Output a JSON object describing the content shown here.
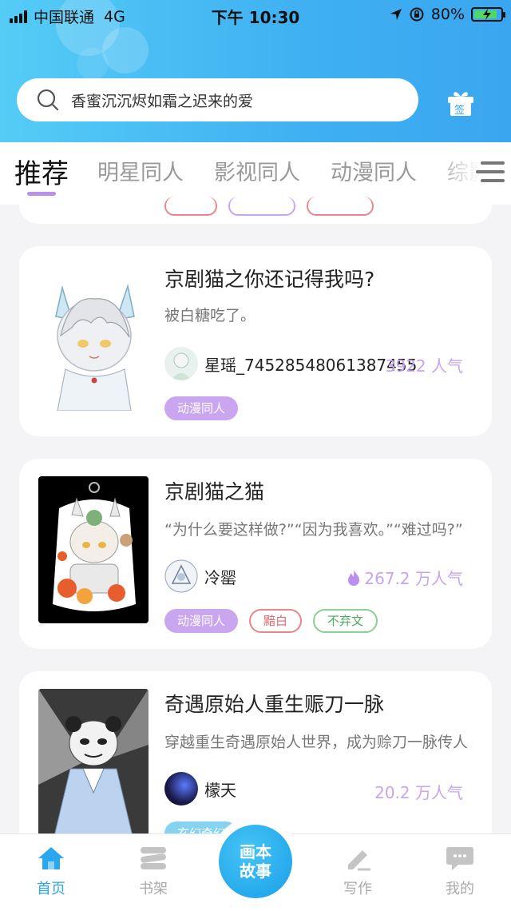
{
  "status_bar": {
    "carrier": "中国联通",
    "network": "4G",
    "time": "下午 10:30",
    "battery": "80%"
  },
  "search": {
    "placeholder": "香蜜沉沉烬如霜之迟来的爱"
  },
  "gift_button": {
    "label": "签"
  },
  "tabs": [
    {
      "label": "推荐",
      "active": true
    },
    {
      "label": "明星同人"
    },
    {
      "label": "影视同人"
    },
    {
      "label": "动漫同人"
    },
    {
      "label": "综影"
    }
  ],
  "stories": [
    {
      "title": "京剧猫之你还记得我吗?",
      "description": "被白糖吃了。",
      "author": "星瑶_74528548061387455",
      "popularity": "3922 人气",
      "tags": [
        {
          "label": "动漫同人",
          "style": "purple"
        }
      ]
    },
    {
      "title": "京剧猫之猫",
      "description": "“为什么要这样做?”“因为我喜欢。”“难过吗?”",
      "author": "冷罂",
      "popularity": "267.2 万人气",
      "hot": true,
      "tags": [
        {
          "label": "动漫同人",
          "style": "purple"
        },
        {
          "label": "黯白",
          "style": "red"
        },
        {
          "label": "不弃文",
          "style": "green"
        }
      ]
    },
    {
      "title": "奇遇原始人重生赈刀一脉",
      "description": "穿越重生奇遇原始人世界，成为赊刀一脉传人",
      "author": "檬天",
      "popularity": "20.2 万人气",
      "tags": [
        {
          "label": "玄幻奇幻",
          "style": "blue"
        }
      ]
    }
  ],
  "bottom_nav": {
    "items": [
      {
        "label": "首页",
        "active": true
      },
      {
        "label": "书架"
      },
      {
        "label": "写作"
      },
      {
        "label": "我的"
      }
    ],
    "center_button": {
      "line1": "画本",
      "line2": "故事"
    }
  },
  "colors": {
    "header_gradient_start": "#55ccf6",
    "header_gradient_end": "#3aa6f0",
    "accent_purple": "#caa6f1",
    "popularity_text": "#c6a4f0",
    "nav_active": "#2aa7ee"
  }
}
